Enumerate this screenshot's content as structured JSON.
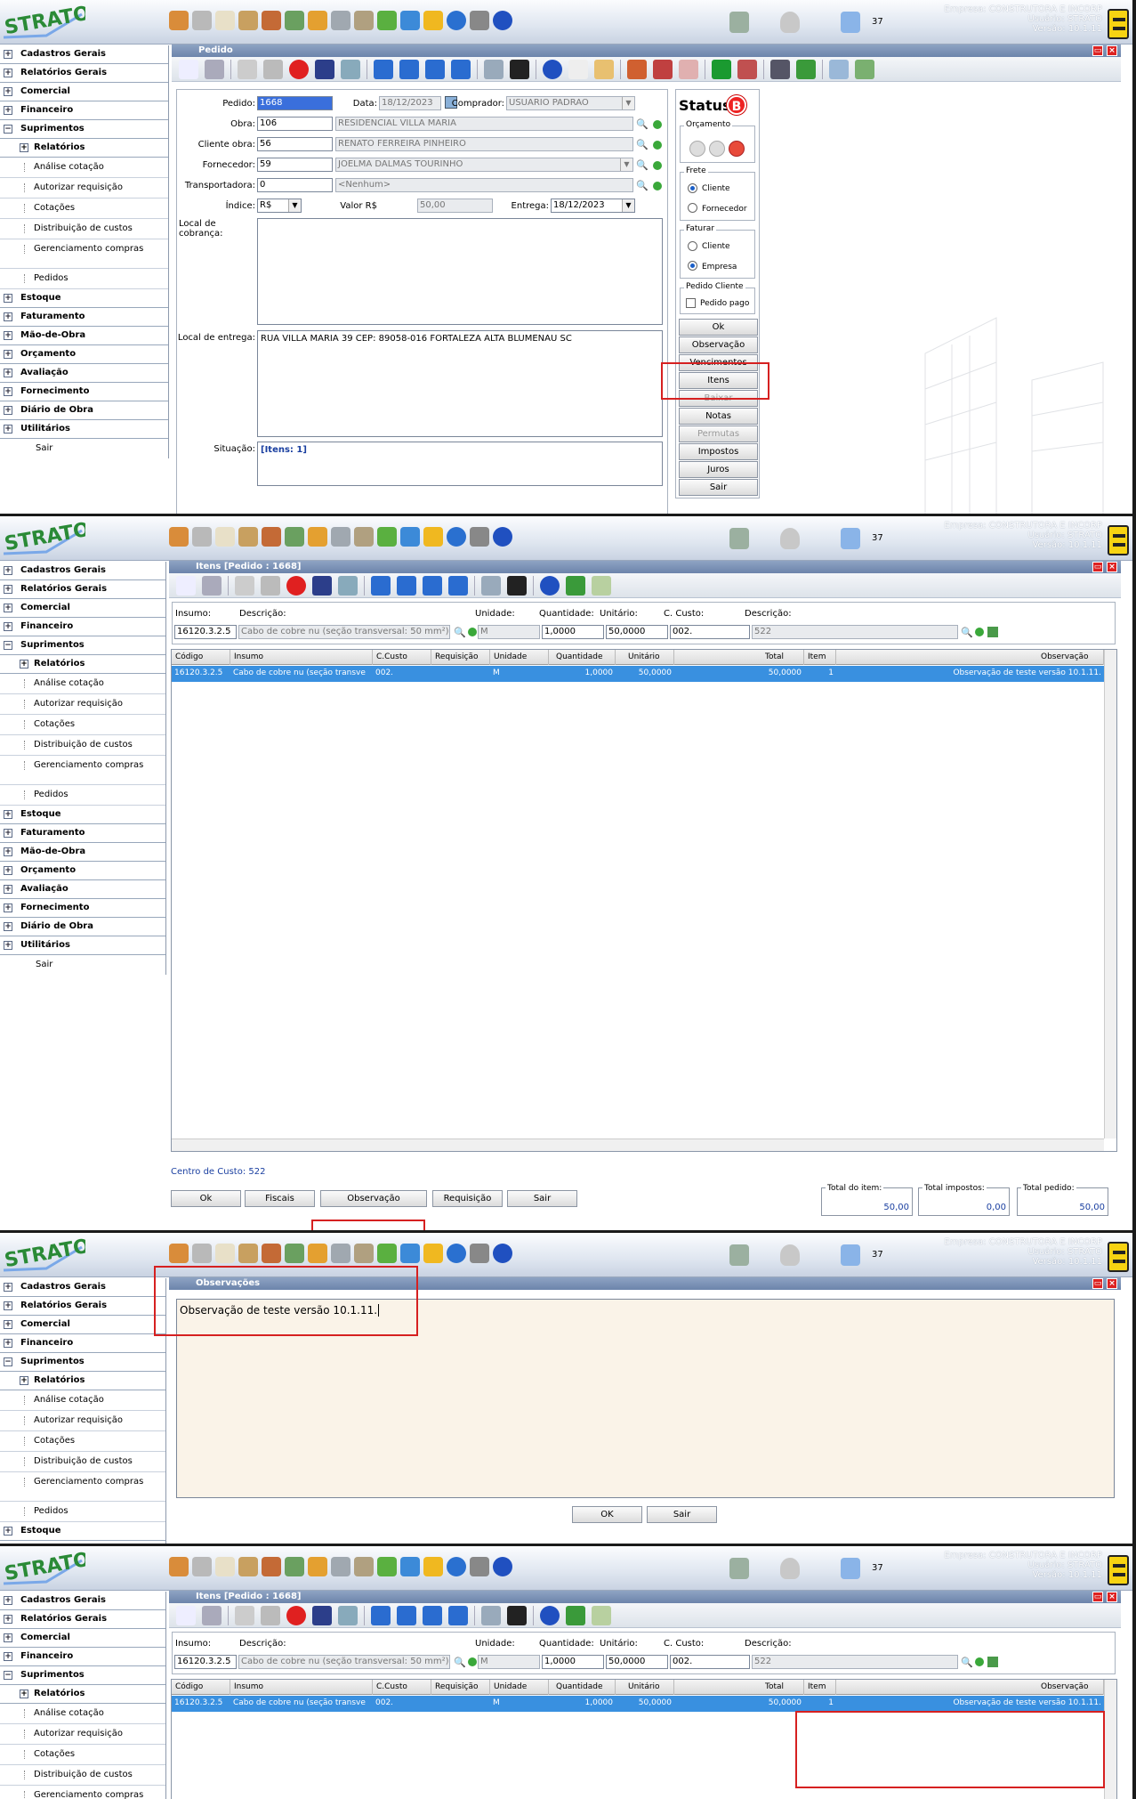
{
  "app": {
    "logo_text": "STRATO",
    "empresa": "Empresa: CONSTRUTORA E INCORP",
    "usuario": "Usuário: STRATO",
    "versao": "Versão: 10.1.11",
    "notif_count": "37"
  },
  "sidebar": {
    "items": [
      "Cadastros Gerais",
      "Relatórios Gerais",
      "Comercial",
      "Financeiro",
      "Suprimentos"
    ],
    "supr_sub_header": "Relatórios",
    "supr_sub": [
      "Análise cotação",
      "Autorizar requisição",
      "Cotações",
      "Distribuição de custos",
      "Gerenciamento compras",
      "Pedidos"
    ],
    "items2": [
      "Estoque",
      "Faturamento",
      "Mão-de-Obra",
      "Orçamento",
      "Avaliação",
      "Fornecimento",
      "Diário de Obra",
      "Utilitários"
    ],
    "sair": "Sair"
  },
  "pedido": {
    "title": "Pedido",
    "lbl_pedido": "Pedido:",
    "val_pedido": "1668",
    "lbl_data": "Data:",
    "val_data": "18/12/2023",
    "lbl_comprador": "Comprador:",
    "val_comprador": "USUARIO PADRAO",
    "lbl_obra": "Obra:",
    "val_obra": "106",
    "val_obra_desc": "RESIDENCIAL VILLA MARIA",
    "lbl_cliente": "Cliente obra:",
    "val_cliente": "56",
    "val_cliente_desc": "RENATO FERREIRA PINHEIRO",
    "lbl_fornecedor": "Fornecedor:",
    "val_fornecedor": "59",
    "val_fornecedor_desc": "JOELMA DALMAS TOURINHO",
    "lbl_transportadora": "Transportadora:",
    "val_transportadora": "0",
    "val_transportadora_desc": "<Nenhum>",
    "lbl_indice": "Índice:",
    "val_indice": "R$",
    "lbl_valor": "Valor R$",
    "val_valor": "50,00",
    "lbl_entrega": "Entrega:",
    "val_entrega": "18/12/2023",
    "lbl_cobranca": "Local de cobrança:",
    "lbl_localentrega": "Local de entrega:",
    "val_localentrega": "RUA VILLA MARIA 39 CEP: 89058-016 FORTALEZA ALTA BLUMENAU SC",
    "lbl_situacao": "Situação:",
    "val_situacao": "[Itens: 1]",
    "status_title": "Status",
    "status_badge": "B",
    "orcamento": "Orçamento",
    "frete": "Frete",
    "frete_cliente": "Cliente",
    "frete_fornecedor": "Fornecedor",
    "faturar": "Faturar",
    "fat_cliente": "Cliente",
    "fat_empresa": "Empresa",
    "pedido_cliente": "Pedido Cliente",
    "pedido_pago": "Pedido pago",
    "buttons": [
      "Ok",
      "Observação",
      "Vencimentos",
      "Itens",
      "Baixar",
      "Notas",
      "Permutas",
      "Impostos",
      "Juros",
      "Sair"
    ]
  },
  "itens": {
    "title": "Itens [Pedido : 1668]",
    "lbl_insumo": "Insumo:",
    "lbl_descricao": "Descrição:",
    "lbl_unidade": "Unidade:",
    "lbl_quantidade": "Quantidade:",
    "lbl_unitario": "Unitário:",
    "lbl_ccusto": "C. Custo:",
    "lbl_descricao2": "Descrição:",
    "val_insumo": "16120.3.2.5",
    "val_descricao": "Cabo de cobre nu  (seção transversal: 50 mm²)",
    "val_unidade": "M",
    "val_quantidade": "1,0000",
    "val_unitario": "50,0000",
    "val_ccusto": "002.",
    "val_descricao2": "522",
    "columns": [
      "Código",
      "Insumo",
      "C.Custo",
      "Requisição",
      "Unidade",
      "Quantidade",
      "Unitário",
      "Total",
      "Item",
      "Observação"
    ],
    "row": [
      "16120.3.2.5",
      "Cabo de cobre nu (seção transve",
      "002.",
      "",
      "M",
      "1,0000",
      "50,0000",
      "50,0000",
      "1",
      "Observação de teste versão 10.1.11."
    ],
    "centro_custo": "Centro de Custo: 522",
    "buttons": [
      "Ok",
      "Fiscais",
      "Observação",
      "Requisição",
      "Sair"
    ],
    "lbl_total_item": "Total do item:",
    "val_total_item": "50,00",
    "lbl_total_impostos": "Total impostos:",
    "val_total_impostos": "0,00",
    "lbl_total_pedido": "Total pedido:",
    "val_total_pedido": "50,00"
  },
  "obs": {
    "title": "Observações",
    "text": "Observação de teste versão 10.1.11.",
    "ok": "OK",
    "sair": "Sair"
  },
  "colors": {
    "accent": "#3990e0",
    "highlight_box": "#d62020",
    "title_bar": "#7a90b6"
  }
}
